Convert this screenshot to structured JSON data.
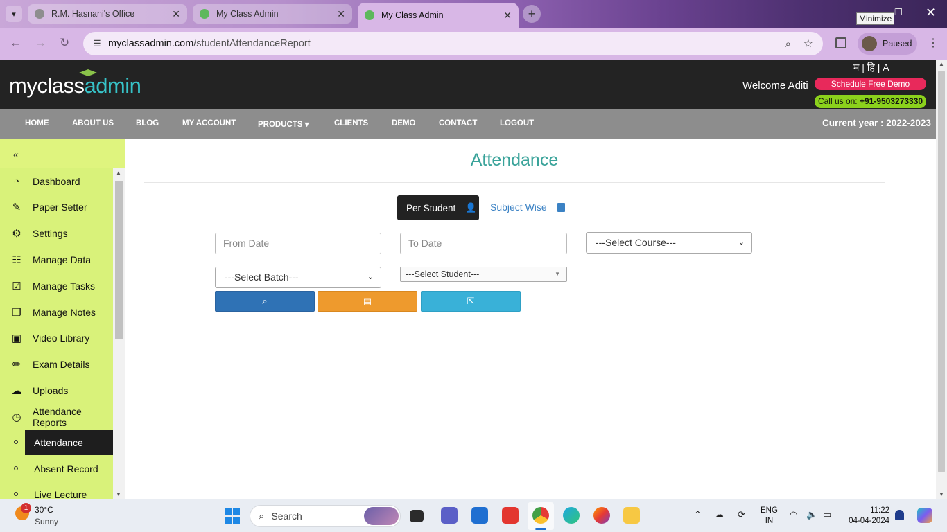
{
  "browser": {
    "tabs": [
      {
        "title": "R.M. Hasnani's Office",
        "active": false
      },
      {
        "title": "My Class Admin",
        "active": false
      },
      {
        "title": "My Class Admin",
        "active": true
      }
    ],
    "url_host": "myclassadmin.com",
    "url_path": "/studentAttendanceReport",
    "profile_status": "Paused",
    "tooltip": "Minimize"
  },
  "site": {
    "logo_my": "myclass",
    "logo_admin": "admin",
    "language_switch": "म | हि | A",
    "welcome": "Welcome Aditi",
    "demo_button": "Schedule Free Demo",
    "call_label": "Call us on: ",
    "call_number": "+91-9503273330",
    "current_year": "Current year : 2022-2023",
    "nav": [
      "HOME",
      "ABOUT US",
      "BLOG",
      "MY ACCOUNT",
      "PRODUCTS",
      "CLIENTS",
      "DEMO",
      "CONTACT",
      "LOGOUT"
    ]
  },
  "sidebar": {
    "collapse": "«",
    "items": [
      {
        "label": "Dashboard",
        "icon": "dashboard-icon"
      },
      {
        "label": "Paper Setter",
        "icon": "edit-icon"
      },
      {
        "label": "Settings",
        "icon": "gear-icon"
      },
      {
        "label": "Manage Data",
        "icon": "list-icon"
      },
      {
        "label": "Manage Tasks",
        "icon": "checkbox-icon"
      },
      {
        "label": "Manage Notes",
        "icon": "copy-icon"
      },
      {
        "label": "Video Library",
        "icon": "video-icon"
      },
      {
        "label": "Exam Details",
        "icon": "pencil-icon"
      },
      {
        "label": "Uploads",
        "icon": "cloud-upload-icon"
      },
      {
        "label": "Attendance Reports",
        "icon": "clock-icon"
      }
    ],
    "subitems": [
      {
        "label": "Attendance",
        "active": true
      },
      {
        "label": "Absent Record",
        "active": false
      },
      {
        "label": "Live Lecture Report",
        "active": false
      }
    ]
  },
  "main": {
    "title": "Attendance",
    "per_student": "Per Student",
    "subject_wise": "Subject Wise",
    "from_date_placeholder": "From Date",
    "to_date_placeholder": "To Date",
    "select_course": "---Select Course---",
    "select_batch": "---Select Batch---",
    "select_student": "---Select Student---",
    "buttons": [
      {
        "name": "search",
        "icon": "search-icon"
      },
      {
        "name": "print",
        "icon": "print-icon"
      },
      {
        "name": "export",
        "icon": "export-icon"
      }
    ],
    "colors": {
      "title": "#3aa39a",
      "search": "#2f72b5",
      "print": "#ee9a2d",
      "export": "#39b1d8",
      "sidebar": "#d9f27a"
    }
  },
  "taskbar": {
    "temperature": "30°C",
    "weather": "Sunny",
    "weather_badge": "1",
    "search_label": "Search",
    "lang_line1": "ENG",
    "lang_line2": "IN",
    "time": "11:22",
    "date": "04-04-2024"
  }
}
